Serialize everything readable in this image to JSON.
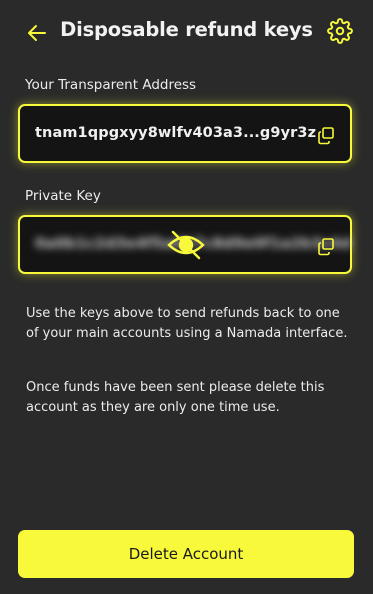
{
  "header": {
    "title": "Disposable refund keys",
    "back_icon": "arrow-left-icon",
    "settings_icon": "gear-icon"
  },
  "transparent_address": {
    "label": "Your Transparent Address",
    "value": "tnam1qpgxyy8wlfv403a3...g9yr3z",
    "copy_icon": "copy-icon"
  },
  "private_key": {
    "label": "Private Key",
    "masked_value": "0a0b1c2d3e4f5a6b7c8d9e0f1a2b3c4d",
    "reveal_icon": "eye-slash-icon",
    "copy_icon": "copy-icon"
  },
  "instructions": {
    "paragraph_1": "Use the keys above to send refunds back to one of your main accounts using a Namada interface.",
    "paragraph_2": "Once funds have been sent please delete this account as they are only one time use."
  },
  "actions": {
    "delete_label": "Delete Account"
  },
  "colors": {
    "accent": "#f7f93a",
    "background": "#2a2a2a",
    "field_background": "#141414",
    "text": "#ffffff"
  }
}
